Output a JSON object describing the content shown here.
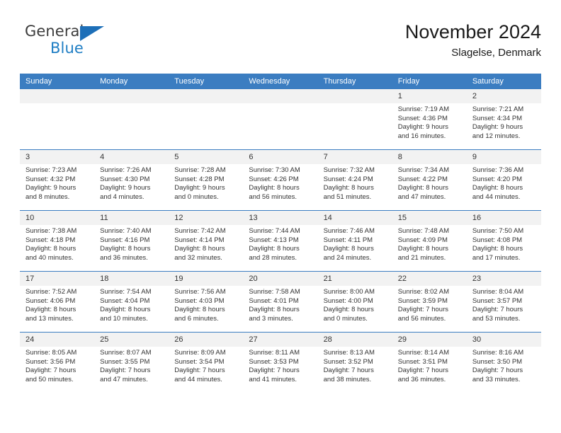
{
  "brand": {
    "word1": "General",
    "word2": "Blue",
    "flag_icon": "triangle-flag-icon",
    "accent_color": "#1d6fb8"
  },
  "header": {
    "title": "November 2024",
    "subtitle": "Slagelse, Denmark"
  },
  "theme": {
    "header_blue": "#3b7dc1",
    "daynum_band": "#f2f2f2",
    "cell_background": "#ffffff",
    "text_color": "#333333"
  },
  "weekday_headers": [
    "Sunday",
    "Monday",
    "Tuesday",
    "Wednesday",
    "Thursday",
    "Friday",
    "Saturday"
  ],
  "weeks": [
    {
      "days": [
        {
          "num": "",
          "sunrise": "",
          "sunset": "",
          "daylight1": "",
          "daylight2": ""
        },
        {
          "num": "",
          "sunrise": "",
          "sunset": "",
          "daylight1": "",
          "daylight2": ""
        },
        {
          "num": "",
          "sunrise": "",
          "sunset": "",
          "daylight1": "",
          "daylight2": ""
        },
        {
          "num": "",
          "sunrise": "",
          "sunset": "",
          "daylight1": "",
          "daylight2": ""
        },
        {
          "num": "",
          "sunrise": "",
          "sunset": "",
          "daylight1": "",
          "daylight2": ""
        },
        {
          "num": "1",
          "sunrise": "Sunrise: 7:19 AM",
          "sunset": "Sunset: 4:36 PM",
          "daylight1": "Daylight: 9 hours",
          "daylight2": "and 16 minutes."
        },
        {
          "num": "2",
          "sunrise": "Sunrise: 7:21 AM",
          "sunset": "Sunset: 4:34 PM",
          "daylight1": "Daylight: 9 hours",
          "daylight2": "and 12 minutes."
        }
      ]
    },
    {
      "days": [
        {
          "num": "3",
          "sunrise": "Sunrise: 7:23 AM",
          "sunset": "Sunset: 4:32 PM",
          "daylight1": "Daylight: 9 hours",
          "daylight2": "and 8 minutes."
        },
        {
          "num": "4",
          "sunrise": "Sunrise: 7:26 AM",
          "sunset": "Sunset: 4:30 PM",
          "daylight1": "Daylight: 9 hours",
          "daylight2": "and 4 minutes."
        },
        {
          "num": "5",
          "sunrise": "Sunrise: 7:28 AM",
          "sunset": "Sunset: 4:28 PM",
          "daylight1": "Daylight: 9 hours",
          "daylight2": "and 0 minutes."
        },
        {
          "num": "6",
          "sunrise": "Sunrise: 7:30 AM",
          "sunset": "Sunset: 4:26 PM",
          "daylight1": "Daylight: 8 hours",
          "daylight2": "and 56 minutes."
        },
        {
          "num": "7",
          "sunrise": "Sunrise: 7:32 AM",
          "sunset": "Sunset: 4:24 PM",
          "daylight1": "Daylight: 8 hours",
          "daylight2": "and 51 minutes."
        },
        {
          "num": "8",
          "sunrise": "Sunrise: 7:34 AM",
          "sunset": "Sunset: 4:22 PM",
          "daylight1": "Daylight: 8 hours",
          "daylight2": "and 47 minutes."
        },
        {
          "num": "9",
          "sunrise": "Sunrise: 7:36 AM",
          "sunset": "Sunset: 4:20 PM",
          "daylight1": "Daylight: 8 hours",
          "daylight2": "and 44 minutes."
        }
      ]
    },
    {
      "days": [
        {
          "num": "10",
          "sunrise": "Sunrise: 7:38 AM",
          "sunset": "Sunset: 4:18 PM",
          "daylight1": "Daylight: 8 hours",
          "daylight2": "and 40 minutes."
        },
        {
          "num": "11",
          "sunrise": "Sunrise: 7:40 AM",
          "sunset": "Sunset: 4:16 PM",
          "daylight1": "Daylight: 8 hours",
          "daylight2": "and 36 minutes."
        },
        {
          "num": "12",
          "sunrise": "Sunrise: 7:42 AM",
          "sunset": "Sunset: 4:14 PM",
          "daylight1": "Daylight: 8 hours",
          "daylight2": "and 32 minutes."
        },
        {
          "num": "13",
          "sunrise": "Sunrise: 7:44 AM",
          "sunset": "Sunset: 4:13 PM",
          "daylight1": "Daylight: 8 hours",
          "daylight2": "and 28 minutes."
        },
        {
          "num": "14",
          "sunrise": "Sunrise: 7:46 AM",
          "sunset": "Sunset: 4:11 PM",
          "daylight1": "Daylight: 8 hours",
          "daylight2": "and 24 minutes."
        },
        {
          "num": "15",
          "sunrise": "Sunrise: 7:48 AM",
          "sunset": "Sunset: 4:09 PM",
          "daylight1": "Daylight: 8 hours",
          "daylight2": "and 21 minutes."
        },
        {
          "num": "16",
          "sunrise": "Sunrise: 7:50 AM",
          "sunset": "Sunset: 4:08 PM",
          "daylight1": "Daylight: 8 hours",
          "daylight2": "and 17 minutes."
        }
      ]
    },
    {
      "days": [
        {
          "num": "17",
          "sunrise": "Sunrise: 7:52 AM",
          "sunset": "Sunset: 4:06 PM",
          "daylight1": "Daylight: 8 hours",
          "daylight2": "and 13 minutes."
        },
        {
          "num": "18",
          "sunrise": "Sunrise: 7:54 AM",
          "sunset": "Sunset: 4:04 PM",
          "daylight1": "Daylight: 8 hours",
          "daylight2": "and 10 minutes."
        },
        {
          "num": "19",
          "sunrise": "Sunrise: 7:56 AM",
          "sunset": "Sunset: 4:03 PM",
          "daylight1": "Daylight: 8 hours",
          "daylight2": "and 6 minutes."
        },
        {
          "num": "20",
          "sunrise": "Sunrise: 7:58 AM",
          "sunset": "Sunset: 4:01 PM",
          "daylight1": "Daylight: 8 hours",
          "daylight2": "and 3 minutes."
        },
        {
          "num": "21",
          "sunrise": "Sunrise: 8:00 AM",
          "sunset": "Sunset: 4:00 PM",
          "daylight1": "Daylight: 8 hours",
          "daylight2": "and 0 minutes."
        },
        {
          "num": "22",
          "sunrise": "Sunrise: 8:02 AM",
          "sunset": "Sunset: 3:59 PM",
          "daylight1": "Daylight: 7 hours",
          "daylight2": "and 56 minutes."
        },
        {
          "num": "23",
          "sunrise": "Sunrise: 8:04 AM",
          "sunset": "Sunset: 3:57 PM",
          "daylight1": "Daylight: 7 hours",
          "daylight2": "and 53 minutes."
        }
      ]
    },
    {
      "days": [
        {
          "num": "24",
          "sunrise": "Sunrise: 8:05 AM",
          "sunset": "Sunset: 3:56 PM",
          "daylight1": "Daylight: 7 hours",
          "daylight2": "and 50 minutes."
        },
        {
          "num": "25",
          "sunrise": "Sunrise: 8:07 AM",
          "sunset": "Sunset: 3:55 PM",
          "daylight1": "Daylight: 7 hours",
          "daylight2": "and 47 minutes."
        },
        {
          "num": "26",
          "sunrise": "Sunrise: 8:09 AM",
          "sunset": "Sunset: 3:54 PM",
          "daylight1": "Daylight: 7 hours",
          "daylight2": "and 44 minutes."
        },
        {
          "num": "27",
          "sunrise": "Sunrise: 8:11 AM",
          "sunset": "Sunset: 3:53 PM",
          "daylight1": "Daylight: 7 hours",
          "daylight2": "and 41 minutes."
        },
        {
          "num": "28",
          "sunrise": "Sunrise: 8:13 AM",
          "sunset": "Sunset: 3:52 PM",
          "daylight1": "Daylight: 7 hours",
          "daylight2": "and 38 minutes."
        },
        {
          "num": "29",
          "sunrise": "Sunrise: 8:14 AM",
          "sunset": "Sunset: 3:51 PM",
          "daylight1": "Daylight: 7 hours",
          "daylight2": "and 36 minutes."
        },
        {
          "num": "30",
          "sunrise": "Sunrise: 8:16 AM",
          "sunset": "Sunset: 3:50 PM",
          "daylight1": "Daylight: 7 hours",
          "daylight2": "and 33 minutes."
        }
      ]
    }
  ]
}
